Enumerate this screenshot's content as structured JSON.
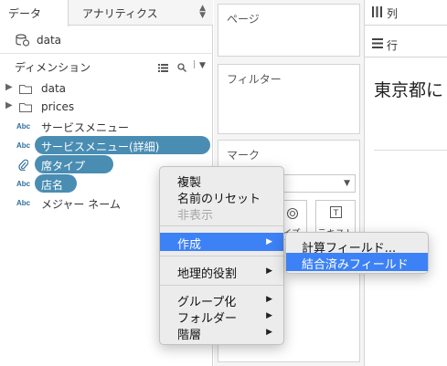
{
  "tabs": {
    "data": "データ",
    "analytics": "アナリティクス"
  },
  "datasource": {
    "name": "data"
  },
  "dimensions": {
    "title": "ディメンション",
    "folders": [
      {
        "label": "data"
      },
      {
        "label": "prices"
      }
    ],
    "fields": [
      {
        "type": "Abc",
        "label": "サービスメニュー"
      },
      {
        "type": "Abc",
        "label": "サービスメニュー(詳細)"
      },
      {
        "type": "link",
        "label": "席タイプ"
      },
      {
        "type": "Abc",
        "label": "店名"
      },
      {
        "type": "Abc",
        "label": "メジャー ネーム"
      }
    ]
  },
  "shelves": {
    "pages": "ページ",
    "filters": "フィルター",
    "marks": "マーク",
    "mark_buttons": [
      "イズ",
      "テキスト"
    ],
    "columns": "列",
    "rows": "行"
  },
  "view": {
    "title": "東京都に"
  },
  "context_menu": {
    "items": {
      "duplicate": "複製",
      "reset_name": "名前のリセット",
      "hide": "非表示",
      "create": "作成",
      "geo_role": "地理的役割",
      "group_by": "グループ化",
      "folders": "フォルダー",
      "hierarchy": "階層"
    }
  },
  "submenu": {
    "calc_field": "計算フィールド...",
    "combined_field": "結合済みフィールド"
  },
  "colors": {
    "accent": "#3d81f6",
    "pill": "#4a8db3",
    "dimension_text": "#2f6f9c"
  }
}
